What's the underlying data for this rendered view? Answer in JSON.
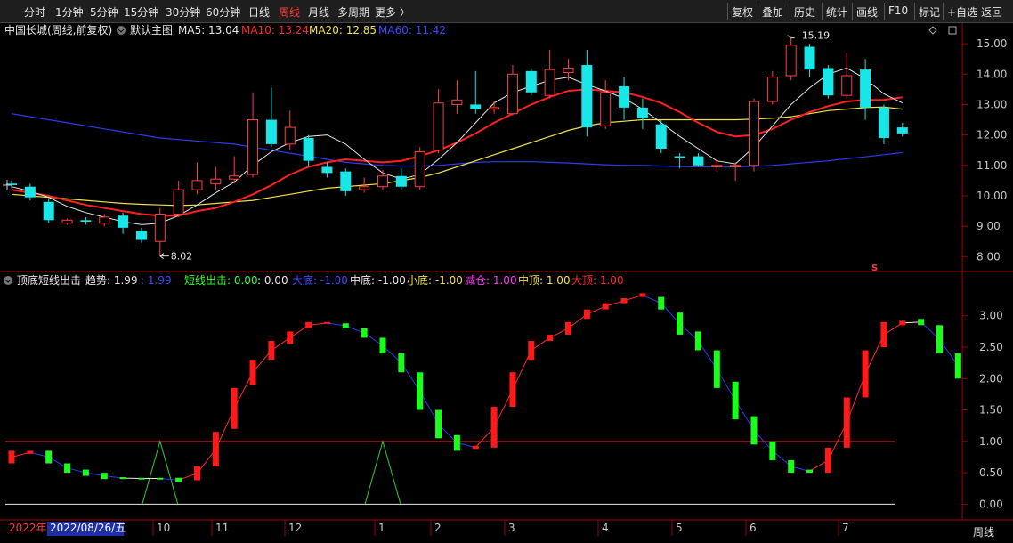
{
  "toolbar": {
    "timeframes": [
      "分时",
      "1分钟",
      "5分钟",
      "15分钟",
      "30分钟",
      "60分钟",
      "日线",
      "周线",
      "月线",
      "多周期",
      "更多 〉"
    ],
    "active": "周线",
    "right_buttons": [
      "复权",
      "叠加",
      "历史",
      "统计",
      "画线",
      "F10",
      "标记",
      "+自选",
      "返回"
    ]
  },
  "main_chart": {
    "stock_name": "中国长城(周线,前复权)",
    "template_label": "默认主图",
    "ma_legend": [
      {
        "label": "MA5: 13.04",
        "color": "#e8e8e8"
      },
      {
        "label": "MA10: 13.24",
        "color": "#ff2a2a"
      },
      {
        "label": "MA20: 12.85",
        "color": "#f0e14a"
      },
      {
        "label": "MA60: 11.42",
        "color": "#3a4cff"
      }
    ],
    "price_axis": [
      "15.00",
      "14.00",
      "13.00",
      "12.00",
      "11.00",
      "10.00",
      "9.00",
      "8.00"
    ],
    "max_label": "15.19",
    "min_label": "8.02",
    "side_mark": "S"
  },
  "indicator": {
    "name": "顶底短线出击",
    "legend": [
      {
        "label": "趋势: 1.99",
        "color": "#e8e8e8"
      },
      {
        "label": ": 1.99",
        "color": "#3a4cff"
      },
      {
        "label": "短线出击: 0.00",
        "color": "#33ff33"
      },
      {
        "label": ": 0.00",
        "color": "#e8e8e8"
      },
      {
        "label": "大底: -1.00",
        "color": "#3a4cff"
      },
      {
        "label": "中底: -1.00",
        "color": "#e8e8e8"
      },
      {
        "label": "小底: -1.00",
        "color": "#f0e14a"
      },
      {
        "label": "减仓: 1.00",
        "color": "#ff33ff"
      },
      {
        "label": "中顶: 1.00",
        "color": "#f0e14a"
      },
      {
        "label": "大顶: 1.00",
        "color": "#ff2a2a"
      }
    ],
    "axis": [
      "3.00",
      "2.50",
      "2.00",
      "1.50",
      "1.00",
      "0.50",
      "0.00"
    ]
  },
  "time_axis": {
    "year_label": "2022年",
    "cursor_date": "2022/08/26/五",
    "months": [
      "10",
      "11",
      "12",
      "1",
      "2",
      "3",
      "4",
      "5",
      "6",
      "7"
    ],
    "period_button": "周线"
  },
  "chart_data": {
    "type": "candlestick",
    "price_range": [
      7.6,
      15.5
    ],
    "candles": [
      {
        "o": 10.4,
        "c": 10.35,
        "h": 10.5,
        "l": 10.25
      },
      {
        "o": 10.3,
        "c": 9.95,
        "h": 10.4,
        "l": 9.85
      },
      {
        "o": 9.8,
        "c": 9.2,
        "h": 9.9,
        "l": 9.1
      },
      {
        "o": 9.1,
        "c": 9.2,
        "h": 9.25,
        "l": 9.05
      },
      {
        "o": 9.2,
        "c": 9.15,
        "h": 9.3,
        "l": 9.05
      },
      {
        "o": 9.1,
        "c": 9.3,
        "h": 9.4,
        "l": 9.0
      },
      {
        "o": 9.35,
        "c": 8.95,
        "h": 9.45,
        "l": 8.75
      },
      {
        "o": 8.85,
        "c": 8.55,
        "h": 8.95,
        "l": 8.45
      },
      {
        "o": 8.5,
        "c": 9.4,
        "h": 9.6,
        "l": 8.02
      },
      {
        "o": 9.4,
        "c": 10.2,
        "h": 10.5,
        "l": 9.3
      },
      {
        "o": 10.2,
        "c": 10.5,
        "h": 11.1,
        "l": 10.05
      },
      {
        "o": 10.4,
        "c": 10.55,
        "h": 10.95,
        "l": 10.2
      },
      {
        "o": 10.55,
        "c": 10.65,
        "h": 11.3,
        "l": 10.4
      },
      {
        "o": 10.7,
        "c": 12.5,
        "h": 13.4,
        "l": 10.6
      },
      {
        "o": 12.5,
        "c": 11.7,
        "h": 13.55,
        "l": 11.6
      },
      {
        "o": 11.7,
        "c": 12.25,
        "h": 12.8,
        "l": 11.5
      },
      {
        "o": 11.9,
        "c": 11.15,
        "h": 12.0,
        "l": 10.95
      },
      {
        "o": 10.95,
        "c": 10.75,
        "h": 11.1,
        "l": 10.6
      },
      {
        "o": 10.8,
        "c": 10.15,
        "h": 10.9,
        "l": 10.0
      },
      {
        "o": 10.2,
        "c": 10.3,
        "h": 10.6,
        "l": 10.1
      },
      {
        "o": 10.3,
        "c": 10.65,
        "h": 10.85,
        "l": 10.2
      },
      {
        "o": 10.65,
        "c": 10.3,
        "h": 10.9,
        "l": 10.2
      },
      {
        "o": 10.3,
        "c": 11.45,
        "h": 11.6,
        "l": 10.2
      },
      {
        "o": 11.5,
        "c": 13.05,
        "h": 13.5,
        "l": 11.4
      },
      {
        "o": 13.0,
        "c": 13.15,
        "h": 13.8,
        "l": 12.7
      },
      {
        "o": 13.0,
        "c": 12.85,
        "h": 14.1,
        "l": 12.7
      },
      {
        "o": 12.85,
        "c": 12.9,
        "h": 13.1,
        "l": 12.7
      },
      {
        "o": 12.7,
        "c": 14.0,
        "h": 14.3,
        "l": 12.65
      },
      {
        "o": 14.1,
        "c": 13.4,
        "h": 14.2,
        "l": 13.3
      },
      {
        "o": 13.3,
        "c": 14.15,
        "h": 14.8,
        "l": 13.2
      },
      {
        "o": 14.05,
        "c": 14.2,
        "h": 14.5,
        "l": 13.8
      },
      {
        "o": 14.3,
        "c": 12.25,
        "h": 14.8,
        "l": 11.95
      },
      {
        "o": 12.3,
        "c": 13.4,
        "h": 13.8,
        "l": 12.2
      },
      {
        "o": 13.6,
        "c": 12.9,
        "h": 13.9,
        "l": 12.5
      },
      {
        "o": 12.9,
        "c": 12.55,
        "h": 13.2,
        "l": 12.2
      },
      {
        "o": 12.35,
        "c": 11.55,
        "h": 12.5,
        "l": 11.4
      },
      {
        "o": 11.3,
        "c": 11.25,
        "h": 11.4,
        "l": 10.9
      },
      {
        "o": 11.3,
        "c": 11.0,
        "h": 11.4,
        "l": 10.95
      },
      {
        "o": 10.95,
        "c": 11.0,
        "h": 11.2,
        "l": 10.8
      },
      {
        "o": 10.95,
        "c": 11.0,
        "h": 11.1,
        "l": 10.5
      },
      {
        "o": 11.0,
        "c": 13.1,
        "h": 13.2,
        "l": 10.8
      },
      {
        "o": 13.1,
        "c": 13.9,
        "h": 14.1,
        "l": 13.0
      },
      {
        "o": 13.95,
        "c": 14.95,
        "h": 15.19,
        "l": 13.8
      },
      {
        "o": 14.9,
        "c": 14.15,
        "h": 15.0,
        "l": 13.9
      },
      {
        "o": 14.2,
        "c": 13.3,
        "h": 14.3,
        "l": 13.2
      },
      {
        "o": 13.3,
        "c": 13.95,
        "h": 14.7,
        "l": 13.2
      },
      {
        "o": 14.15,
        "c": 12.9,
        "h": 14.5,
        "l": 12.5
      },
      {
        "o": 12.9,
        "c": 11.9,
        "h": 13.0,
        "l": 11.7
      },
      {
        "o": 12.25,
        "c": 12.05,
        "h": 12.4,
        "l": 11.95
      }
    ],
    "ma5": [
      10.3,
      10.15,
      9.95,
      9.65,
      9.45,
      9.3,
      9.15,
      9.05,
      9.1,
      9.35,
      9.7,
      10.1,
      10.45,
      11.0,
      11.45,
      11.75,
      11.95,
      12.0,
      11.7,
      11.2,
      10.75,
      10.55,
      10.7,
      11.2,
      11.75,
      12.4,
      13.05,
      13.4,
      13.6,
      13.8,
      13.9,
      13.65,
      13.45,
      13.2,
      12.85,
      12.4,
      11.95,
      11.55,
      11.15,
      11.05,
      11.6,
      12.3,
      13.0,
      13.55,
      14.0,
      14.2,
      13.85,
      13.35,
      13.05
    ],
    "ma10": [
      10.2,
      10.1,
      10.0,
      9.85,
      9.7,
      9.6,
      9.5,
      9.4,
      9.35,
      9.35,
      9.5,
      9.6,
      9.8,
      10.05,
      10.35,
      10.7,
      10.95,
      11.1,
      11.2,
      11.15,
      11.1,
      11.15,
      11.3,
      11.5,
      11.75,
      12.05,
      12.4,
      12.7,
      13.0,
      13.25,
      13.45,
      13.5,
      13.45,
      13.4,
      13.25,
      13.05,
      12.75,
      12.4,
      12.1,
      11.95,
      12.0,
      12.2,
      12.5,
      12.75,
      12.95,
      13.1,
      13.15,
      13.15,
      13.24
    ],
    "ma20": [
      10.05,
      10.0,
      9.95,
      9.9,
      9.85,
      9.8,
      9.75,
      9.72,
      9.7,
      9.68,
      9.7,
      9.75,
      9.8,
      9.85,
      9.95,
      10.05,
      10.15,
      10.25,
      10.3,
      10.35,
      10.4,
      10.5,
      10.6,
      10.75,
      10.95,
      11.15,
      11.35,
      11.55,
      11.75,
      11.95,
      12.15,
      12.3,
      12.4,
      12.45,
      12.5,
      12.5,
      12.5,
      12.5,
      12.5,
      12.5,
      12.52,
      12.55,
      12.6,
      12.7,
      12.8,
      12.85,
      12.9,
      12.92,
      12.85
    ],
    "ma60": [
      12.7,
      12.6,
      12.5,
      12.4,
      12.3,
      12.2,
      12.1,
      12.0,
      11.9,
      11.85,
      11.8,
      11.75,
      11.7,
      11.6,
      11.5,
      11.4,
      11.3,
      11.2,
      11.1,
      11.05,
      11.0,
      10.98,
      10.98,
      11.0,
      11.05,
      11.1,
      11.12,
      11.12,
      11.12,
      11.1,
      11.08,
      11.05,
      11.02,
      11.0,
      11.0,
      10.98,
      10.96,
      10.95,
      10.95,
      10.95,
      10.97,
      11.0,
      11.05,
      11.1,
      11.15,
      11.22,
      11.28,
      11.35,
      11.42
    ],
    "indicator_range": [
      -0.25,
      3.45
    ],
    "indicator_bars": [
      {
        "o": 0.85,
        "c": 0.65,
        "up": true
      },
      {
        "o": 0.85,
        "c": 0.8,
        "up": true
      },
      {
        "o": 0.65,
        "c": 0.85,
        "up": false
      },
      {
        "o": 0.5,
        "c": 0.65,
        "up": false
      },
      {
        "o": 0.45,
        "c": 0.55,
        "up": false
      },
      {
        "o": 0.4,
        "c": 0.5,
        "up": false
      },
      {
        "o": 0.4,
        "c": 0.43,
        "up": false
      },
      {
        "o": 0.4,
        "c": 0.42,
        "up": false
      },
      {
        "o": 0.4,
        "c": 0.42,
        "up": false
      },
      {
        "o": 0.35,
        "c": 0.42,
        "up": false
      },
      {
        "o": 0.38,
        "c": 0.6,
        "up": true
      },
      {
        "o": 0.6,
        "c": 1.15,
        "up": true
      },
      {
        "o": 1.2,
        "c": 1.85,
        "up": true
      },
      {
        "o": 1.9,
        "c": 2.3,
        "up": true
      },
      {
        "o": 2.3,
        "c": 2.6,
        "up": true
      },
      {
        "o": 2.55,
        "c": 2.75,
        "up": true
      },
      {
        "o": 2.8,
        "c": 2.9,
        "up": true
      },
      {
        "o": 2.87,
        "c": 2.9,
        "up": true
      },
      {
        "o": 2.8,
        "c": 2.88,
        "up": false
      },
      {
        "o": 2.65,
        "c": 2.8,
        "up": false
      },
      {
        "o": 2.4,
        "c": 2.65,
        "up": false
      },
      {
        "o": 2.1,
        "c": 2.4,
        "up": false
      },
      {
        "o": 1.5,
        "c": 2.1,
        "up": false
      },
      {
        "o": 1.05,
        "c": 1.5,
        "up": false
      },
      {
        "o": 0.85,
        "c": 1.1,
        "up": false
      },
      {
        "o": 0.88,
        "c": 0.93,
        "up": true
      },
      {
        "o": 0.9,
        "c": 1.55,
        "up": true
      },
      {
        "o": 1.55,
        "c": 2.1,
        "up": true
      },
      {
        "o": 2.3,
        "c": 2.6,
        "up": true
      },
      {
        "o": 2.6,
        "c": 2.7,
        "up": true
      },
      {
        "o": 2.7,
        "c": 2.9,
        "up": true
      },
      {
        "o": 2.95,
        "c": 3.1,
        "up": true
      },
      {
        "o": 3.1,
        "c": 3.2,
        "up": true
      },
      {
        "o": 3.2,
        "c": 3.28,
        "up": true
      },
      {
        "o": 3.3,
        "c": 3.36,
        "up": true
      },
      {
        "o": 3.1,
        "c": 3.3,
        "up": false
      },
      {
        "o": 2.7,
        "c": 3.05,
        "up": false
      },
      {
        "o": 2.45,
        "c": 2.75,
        "up": false
      },
      {
        "o": 1.85,
        "c": 2.45,
        "up": false
      },
      {
        "o": 1.35,
        "c": 1.95,
        "up": false
      },
      {
        "o": 0.95,
        "c": 1.4,
        "up": false
      },
      {
        "o": 0.7,
        "c": 1.0,
        "up": false
      },
      {
        "o": 0.5,
        "c": 0.7,
        "up": false
      },
      {
        "o": 0.5,
        "c": 0.55,
        "up": false
      },
      {
        "o": 0.5,
        "c": 0.9,
        "up": true
      },
      {
        "o": 0.9,
        "c": 1.7,
        "up": true
      },
      {
        "o": 1.7,
        "c": 2.45,
        "up": true
      },
      {
        "o": 2.5,
        "c": 2.9,
        "up": true
      },
      {
        "o": 2.85,
        "c": 2.92,
        "up": true
      }
    ],
    "indicator_tail": [
      {
        "o": 2.85,
        "c": 2.95,
        "up": false
      },
      {
        "o": 2.4,
        "c": 2.85,
        "up": false
      },
      {
        "o": 2.0,
        "c": 2.4,
        "up": false
      }
    ],
    "signal_levels": [
      0.0,
      1.0
    ],
    "signal_peaks": [
      8,
      20
    ],
    "separator_level": -1.0
  }
}
